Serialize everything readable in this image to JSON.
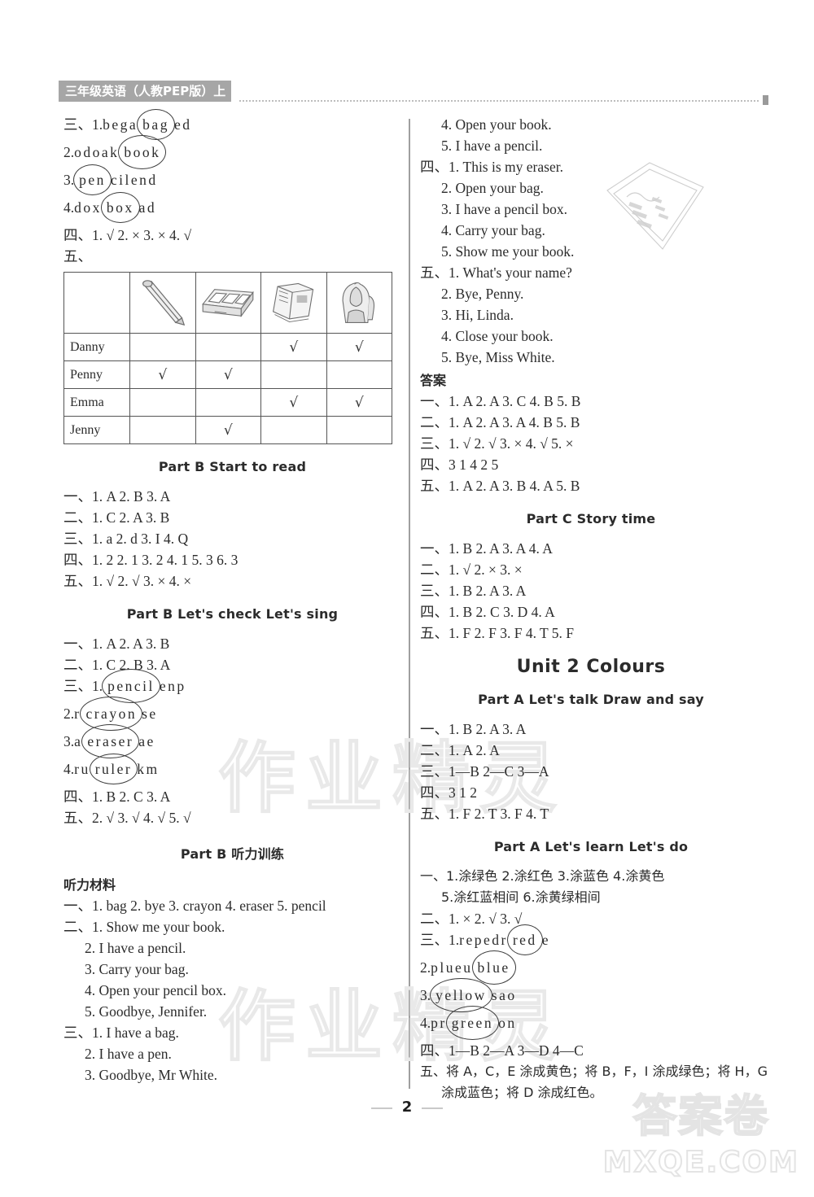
{
  "header": {
    "book_title": "三年级英语（人教PEP版）上"
  },
  "footer": {
    "page_number": "2"
  },
  "watermarks": {
    "text": "作业精灵",
    "logo_big": "答案卷",
    "logo_small": "MXQE.COM"
  },
  "left_column": {
    "block1": {
      "lines": [
        {
          "label": "三、1.",
          "pre": "bega",
          "circle": "bag",
          "post": "ed"
        },
        {
          "label": "2.",
          "pre": "odoak",
          "circle": "book",
          "post": ""
        },
        {
          "label": "3.",
          "pre": "",
          "circle": "pen",
          "post": "cilend"
        },
        {
          "label": "4.",
          "pre": "dox",
          "circle": "box",
          "post": "ad"
        }
      ]
    },
    "block2": {
      "line_si": "四、1. √   2. ×   3. ×   4. √",
      "line_wu": "五、"
    },
    "table": {
      "columns": [
        "pencil-icon",
        "pencil-box-icon",
        "book-icon",
        "backpack-icon"
      ],
      "rows": [
        {
          "name": "Danny",
          "checks": [
            false,
            false,
            true,
            true
          ]
        },
        {
          "name": "Penny",
          "checks": [
            true,
            true,
            false,
            false
          ]
        },
        {
          "name": "Emma",
          "checks": [
            false,
            false,
            true,
            true
          ]
        },
        {
          "name": "Jenny",
          "checks": [
            false,
            true,
            false,
            false
          ]
        }
      ],
      "check_glyph": "√"
    },
    "part_b_start_to_read": {
      "heading": "Part B   Start to read",
      "lines": [
        "一、1. A   2. B   3. A",
        "二、1. C   2. A   3. B",
        "三、1. a   2. d   3. I   4. Q",
        "四、1. 2   2. 1   3. 2   4. 1   5. 3   6. 3",
        "五、1. √   2. √   3. ×   4. ×"
      ]
    },
    "part_b_lets_check": {
      "heading": "Part B   Let's check   Let's sing",
      "lines_top": [
        "一、1. A   2. A   3. B",
        "二、1. C   2. B   3. A"
      ],
      "puzzles": [
        {
          "label": "三、1.",
          "pre": "",
          "circle": "pencil",
          "post": "enp"
        },
        {
          "label": "2.",
          "pre": "r",
          "circle": "crayon",
          "post": "se"
        },
        {
          "label": "3.",
          "pre": "a",
          "circle": "eraser",
          "post": "ae"
        },
        {
          "label": "4.",
          "pre": "ru",
          "circle": "ruler",
          "post": "km"
        }
      ],
      "lines_bottom": [
        "四、1. B   2. C   3. A",
        "五、2. √   3. √   4. √   5. √"
      ]
    },
    "part_b_listening": {
      "heading": "Part B    听力训练",
      "subheading": "听力材料",
      "lines": [
        "一、1. bag   2. bye   3. crayon   4. eraser   5. pencil",
        "二、1. Show me your book.",
        "2. I have a pencil.",
        "3. Carry your bag.",
        "4. Open your pencil box.",
        "5. Goodbye, Jennifer.",
        "三、1. I have a bag.",
        "2. I have a pen.",
        "3. Goodbye, Mr White."
      ],
      "indents": [
        0,
        0,
        1,
        1,
        1,
        1,
        0,
        1,
        1
      ]
    }
  },
  "right_column": {
    "listening_continued": {
      "lines": [
        "4. Open your book.",
        "5. I have a pencil.",
        "四、1. This is my eraser.",
        "2. Open your bag.",
        "3. I have a pencil box.",
        "4. Carry your bag.",
        "5. Show me your book.",
        "五、1. What's your name?",
        "2. Bye, Penny.",
        "3. Hi, Linda.",
        "4. Close your book.",
        "5. Bye, Miss White."
      ],
      "indents": [
        1,
        1,
        0,
        1,
        1,
        1,
        1,
        0,
        1,
        1,
        1,
        1
      ]
    },
    "answers": {
      "heading": "答案",
      "lines": [
        "一、1. A   2. A   3. C   4. B   5. B",
        "二、1. A   2. A   3. A   4. B   5. B",
        "三、1. √   2. √   3. ×   4. √   5. ×",
        "四、3  1  4  2  5",
        "五、1. A   2. A   3. B   4. A   5. B"
      ]
    },
    "part_c_story_time": {
      "heading": "Part C   Story time",
      "lines": [
        "一、1. B   2. A   3. A   4. A",
        "二、1. √   2. ×   3. ×",
        "三、1. B   2. A   3. A",
        "四、1. B   2. C   3. D   4. A",
        "五、1. F   2. F   3. F   4. T   5. F"
      ]
    },
    "unit2": {
      "heading": "Unit 2   Colours"
    },
    "part_a_lets_talk": {
      "heading": "Part A   Let's talk   Draw and say",
      "lines": [
        "一、1. B   2. A   3. A",
        "二、1. A   2. A",
        "三、1—B   2—C   3—A",
        "四、3  1  2",
        "五、1. F   2. T   3. F   4. T"
      ]
    },
    "part_a_lets_learn": {
      "heading": "Part A   Let's learn   Let's do",
      "lines_top": [
        "一、1.涂绿色   2.涂红色   3.涂蓝色   4.涂黄色",
        "5.涂红蓝相间   6.涂黄绿相间",
        "二、1. ×   2. √   3. √"
      ],
      "indents_top": [
        0,
        1,
        0
      ],
      "puzzles": [
        {
          "label": "三、1.",
          "pre": "repedr",
          "circle": "red",
          "post": "e"
        },
        {
          "label": "2.",
          "pre": "plueu",
          "circle": "blue",
          "post": ""
        },
        {
          "label": "3.",
          "pre": "",
          "circle": "yellow",
          "post": "sao"
        },
        {
          "label": "4.",
          "pre": "pr",
          "circle": "green",
          "post": "on"
        }
      ],
      "lines_bottom": [
        "四、1—B   2—A   3—D   4—C",
        "五、将 A，C，E 涂成黄色；将 B，F，I 涂成绿色；将 H，G",
        "涂成蓝色；将 D 涂成红色。"
      ],
      "indents_bottom": [
        0,
        0,
        1
      ]
    }
  }
}
